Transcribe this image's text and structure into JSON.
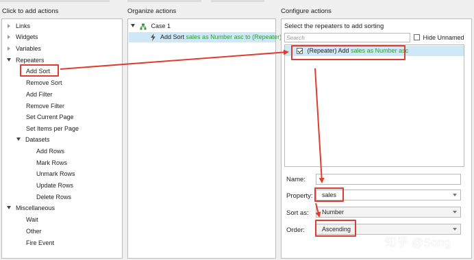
{
  "headers": {
    "left": "Click to add actions",
    "middle": "Organize actions",
    "right": "Configure actions"
  },
  "tree": {
    "links": "Links",
    "widgets": "Widgets",
    "variables": "Variables",
    "repeaters": "Repeaters",
    "repeater_items": [
      "Add Sort",
      "Remove Sort",
      "Add Filter",
      "Remove Filter",
      "Set Current Page",
      "Set Items per Page"
    ],
    "datasets": "Datasets",
    "dataset_items": [
      "Add Rows",
      "Mark Rows",
      "Unmark Rows",
      "Update Rows",
      "Delete Rows"
    ],
    "misc": "Miscellaneous",
    "misc_items": [
      "Wait",
      "Other",
      "Fire Event"
    ]
  },
  "organize": {
    "case": "Case 1",
    "action_prefix": "Add Sort",
    "action_detail": "sales as Number asc to (Repeater)"
  },
  "configure": {
    "title": "Select the repeaters to add sorting",
    "search_placeholder": "Search",
    "hide_unnamed": "Hide Unnamed",
    "item_prefix": "(Repeater) Add",
    "item_detail": "sales as Number asc",
    "name_label": "Name:",
    "name_value": "",
    "property_label": "Property:",
    "property_value": "sales",
    "sortas_label": "Sort as:",
    "sortas_value": "Number",
    "order_label": "Order:",
    "order_value": "Ascending"
  },
  "watermark": "知乎 @Song",
  "colors": {
    "annotation": "#e03b2f",
    "highlight": "#cfe8f7",
    "green_text": "#2e9a3a"
  }
}
